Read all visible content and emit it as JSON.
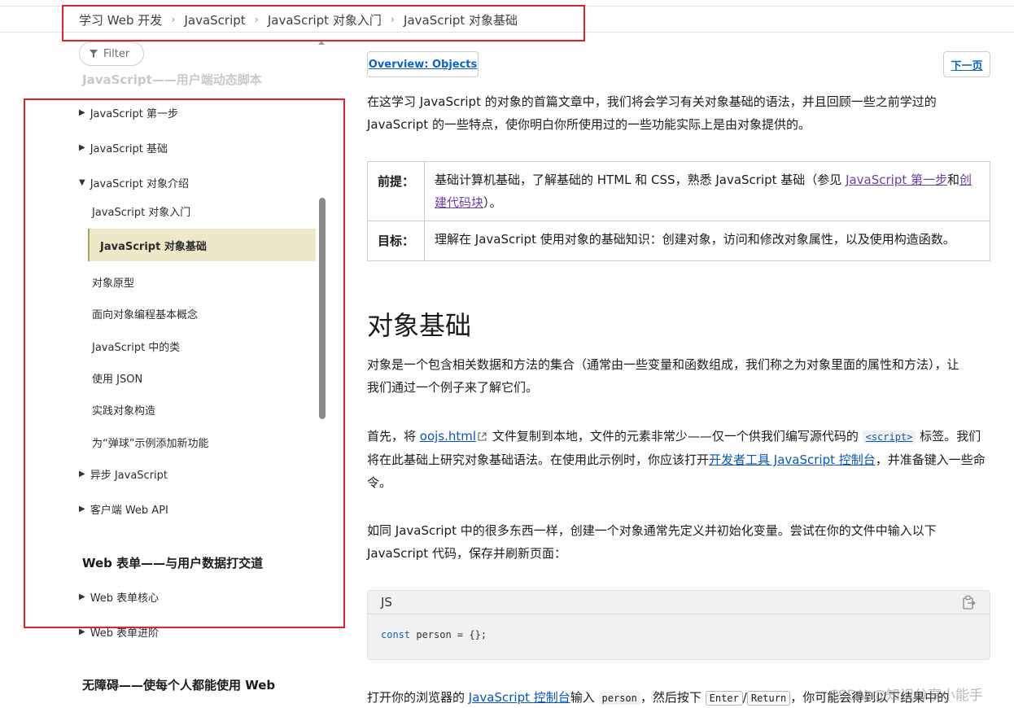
{
  "breadcrumb": {
    "items": [
      "学习 Web 开发",
      "JavaScript",
      "JavaScript 对象入门",
      "JavaScript 对象基础"
    ],
    "separator": "›"
  },
  "sidebar": {
    "filter_label": "Filter",
    "faded_heading": "JavaScript——用户端动态脚本",
    "items": [
      {
        "label": "JavaScript 第一步",
        "toggle": "▶"
      },
      {
        "label": "JavaScript 基础",
        "toggle": "▶"
      },
      {
        "label": "JavaScript 对象介绍",
        "toggle": "▼"
      }
    ],
    "sub_items": [
      "JavaScript 对象入门",
      "JavaScript 对象基础",
      "对象原型",
      "面向对象编程基本概念",
      "JavaScript 中的类",
      "使用 JSON",
      "实践对象构造",
      "为“弹球”示例添加新功能"
    ],
    "active_item": "JavaScript 对象基础",
    "more_items": [
      {
        "label": "异步 JavaScript",
        "toggle": "▶"
      },
      {
        "label": "客户端 Web API",
        "toggle": "▶"
      }
    ],
    "section2_heading": "Web 表单——与用户数据打交道",
    "section2_items": [
      {
        "label": "Web 表单核心",
        "toggle": "▶"
      },
      {
        "label": "Web 表单进阶",
        "toggle": "▶"
      }
    ],
    "section3_heading": "无障碍——使每个人都能使用 Web"
  },
  "main": {
    "overview_link": "Overview: Objects",
    "next_link": "下一页",
    "intro": "在这学习 JavaScript 的对象的首篇文章中，我们将会学习有关对象基础的语法，并且回顾一些之前学过的 JavaScript 的一些特点，使你明白你所使用过的一些功能实际上是由对象提供的。",
    "table": {
      "prereq_label": "前提：",
      "prereq_text_1": "基础计算机基础，了解基础的 HTML 和 CSS，熟悉 JavaScript 基础（参见 ",
      "prereq_link_1": "JavaScript 第一步",
      "prereq_text_2": "和",
      "prereq_link_2": "创建代码块",
      "prereq_text_3": "）。",
      "goal_label": "目标：",
      "goal_text": "理解在 JavaScript 使用对象的基础知识：创建对象，访问和修改对象属性，以及使用构造函数。"
    },
    "heading": "对象基础",
    "para1": "对象是一个包含相关数据和方法的集合（通常由一些变量和函数组成，我们称之为对象里面的属性和方法），让我们通过一个例子来了解它们。",
    "para2": {
      "t1": "首先，将 ",
      "link1": "oojs.html",
      "t2": " 文件复制到本地，文件的元素非常少——仅一个供我们编写源代码的 ",
      "code1": "<script>",
      "t3": " 标签。我们将在此基础上研究对象基础语法。在使用此示例时，你应该打开",
      "link2": "开发者工具 JavaScript 控制台",
      "t4": "，并准备键入一些命令。"
    },
    "para3": "如同 JavaScript 中的很多东西一样，创建一个对象通常先定义并初始化变量。尝试在你的文件中输入以下 JavaScript 代码，保存并刷新页面：",
    "code_lang": "JS",
    "code_kw": "const",
    "code_rest": " person = {};",
    "para4": {
      "t1": "打开你的浏览器的 ",
      "link1": "JavaScript 控制台",
      "t2": "输入 ",
      "code1": "person",
      "t3": "，然后按下 ",
      "kbd1": "Enter",
      "t4": "/",
      "kbd2": "Return",
      "t5": "，你可能会得到以下结果中的"
    }
  },
  "watermark": "CSDN @知识分享小能手",
  "colors": {
    "annotation_red": "#e0202a",
    "active_bg": "#ece8c8",
    "link": "#0a56b9",
    "visited": "#6b3fa0"
  }
}
